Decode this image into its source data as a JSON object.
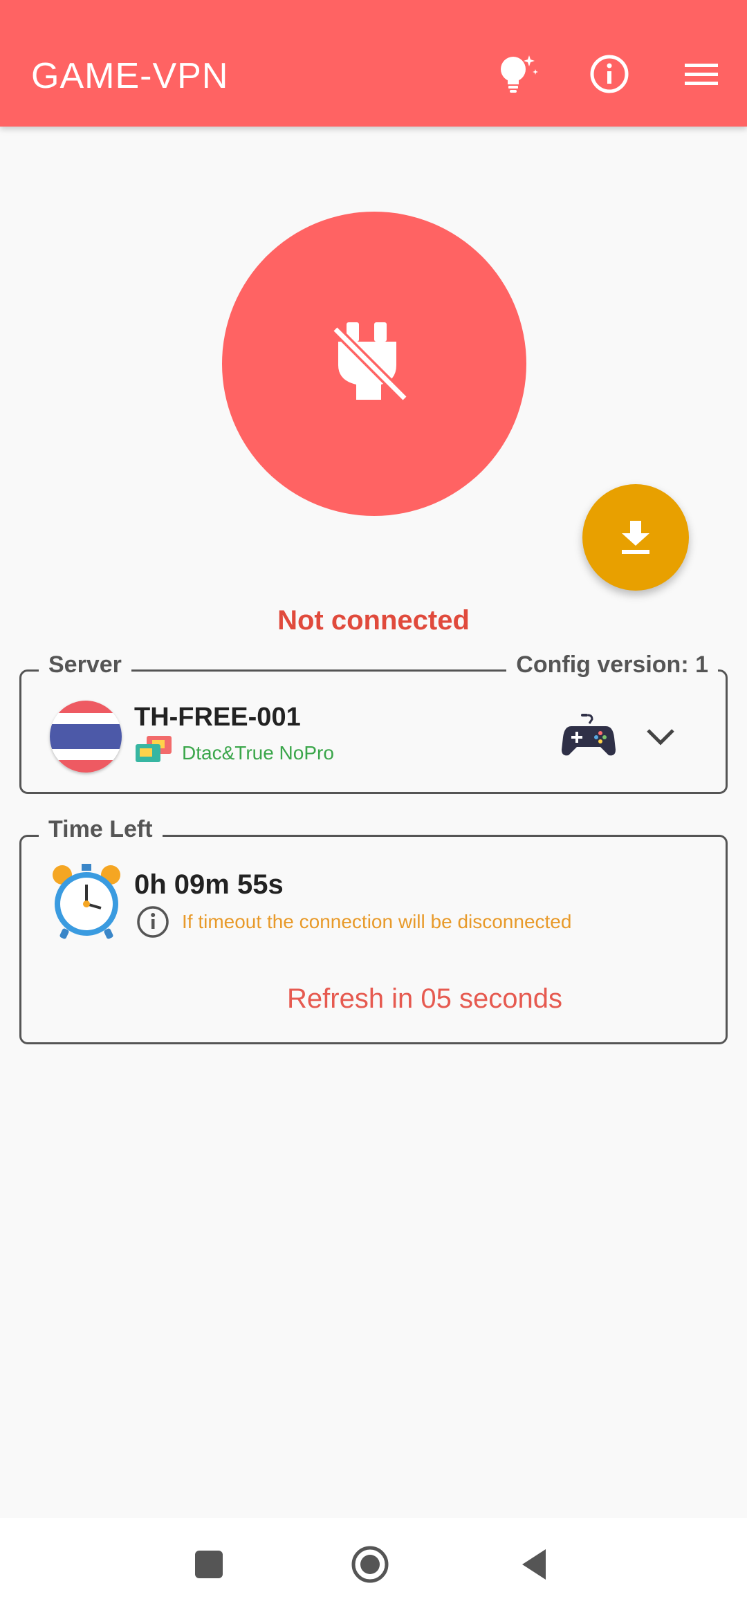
{
  "app_bar": {
    "title": "GAME-VPN",
    "icons": [
      "lightbulb-icon",
      "info-icon",
      "menu-icon"
    ]
  },
  "connect": {
    "icon": "power-plug-off-icon",
    "status": "Not connected"
  },
  "fab": {
    "icon": "download-icon"
  },
  "server_section": {
    "legend": "Server",
    "config_label": "Config version: 1",
    "server_name": "TH-FREE-001",
    "network": "Dtac&True NoPro",
    "icons": [
      "thailand-flag-icon",
      "sim-card-icon",
      "gamepad-icon",
      "chevron-down-icon"
    ]
  },
  "time_section": {
    "legend": "Time Left",
    "time_left": "0h 09m 55s",
    "info": "If timeout the connection will be disconnected",
    "refresh": "Refresh in 05 seconds",
    "icons": [
      "alarm-clock-icon",
      "info-icon"
    ]
  },
  "nav_bar": {
    "icons": [
      "recents-square-icon",
      "home-circle-icon",
      "back-triangle-icon"
    ]
  },
  "colors": {
    "accent": "#ff6363",
    "fab": "#e8a000",
    "status": "#e04a3c",
    "network": "#3aa64a",
    "warning": "#e89a2a",
    "refresh": "#e65a50"
  }
}
